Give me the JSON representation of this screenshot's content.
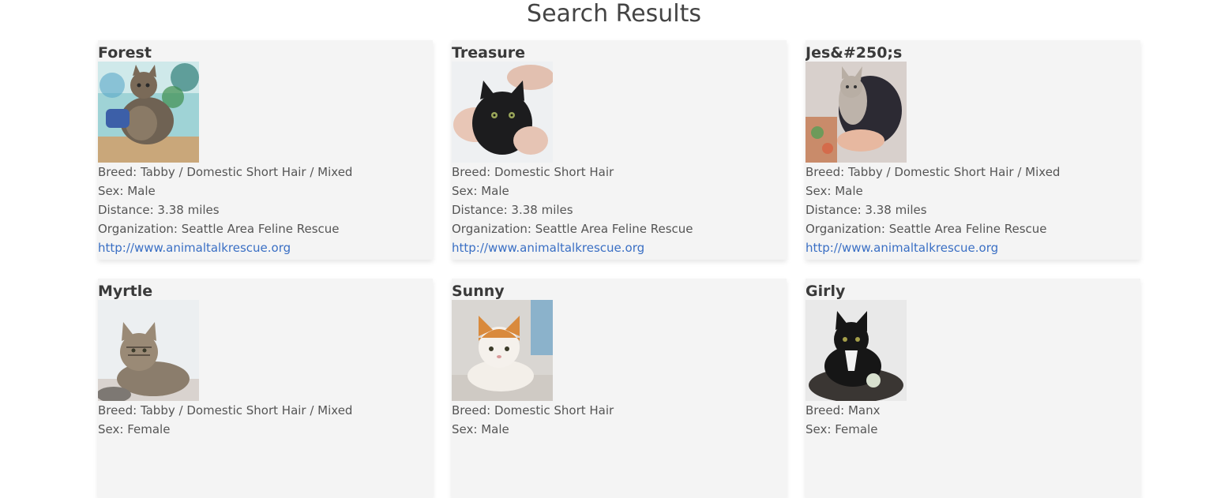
{
  "page": {
    "title": "Search Results"
  },
  "labels": {
    "breed": "Breed: ",
    "sex": "Sex: ",
    "distance": "Distance: ",
    "organization": "Organization: "
  },
  "results": [
    {
      "name": "Forest",
      "breed": "Tabby / Domestic Short Hair / Mixed",
      "sex": "Male",
      "distance": "3.38 miles",
      "organization": "Seattle Area Feline Rescue",
      "url": "http://www.animaltalkrescue.org"
    },
    {
      "name": "Treasure",
      "breed": "Domestic Short Hair",
      "sex": "Male",
      "distance": "3.38 miles",
      "organization": "Seattle Area Feline Rescue",
      "url": "http://www.animaltalkrescue.org"
    },
    {
      "name": "Jes&#250;s",
      "breed": "Tabby / Domestic Short Hair / Mixed",
      "sex": "Male",
      "distance": "3.38 miles",
      "organization": "Seattle Area Feline Rescue",
      "url": "http://www.animaltalkrescue.org"
    },
    {
      "name": "Myrtle",
      "breed": "Tabby / Domestic Short Hair / Mixed",
      "sex": "Female"
    },
    {
      "name": "Sunny",
      "breed": "Domestic Short Hair",
      "sex": "Male"
    },
    {
      "name": "Girly",
      "breed": "Manx",
      "sex": "Female"
    }
  ],
  "colors": {
    "card_bg": "#f4f4f4",
    "link": "#3a6fc4",
    "text": "#444444"
  }
}
